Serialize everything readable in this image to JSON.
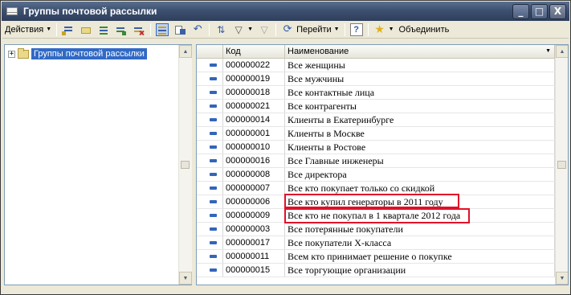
{
  "window": {
    "title": "Группы почтовой рассылки"
  },
  "title_buttons": {
    "minimize": "_",
    "maximize": "□",
    "close": "X"
  },
  "toolbar": {
    "actions_label": "Действия",
    "goto_label": "Перейти",
    "help_label": "?",
    "merge_label": "Объединить"
  },
  "tree": {
    "root_label": "Группы почтовой рассылки",
    "expander": "+"
  },
  "grid": {
    "columns": [
      "Код",
      "Наименование"
    ],
    "rows": [
      {
        "code": "000000022",
        "name": "Все женщины"
      },
      {
        "code": "000000019",
        "name": "Все мужчины"
      },
      {
        "code": "000000018",
        "name": "Все контактные лица"
      },
      {
        "code": "000000021",
        "name": "Все контрагенты"
      },
      {
        "code": "000000014",
        "name": "Клиенты в Екатеринбурге"
      },
      {
        "code": "000000001",
        "name": "Клиенты в Москве"
      },
      {
        "code": "000000010",
        "name": "Клиенты в Ростове"
      },
      {
        "code": "000000016",
        "name": "Все Главные инженеры"
      },
      {
        "code": "000000008",
        "name": "Все директора"
      },
      {
        "code": "000000007",
        "name": "Все кто покупает только со скидкой"
      },
      {
        "code": "000000006",
        "name": "Все кто купил генераторы в 2011 году"
      },
      {
        "code": "000000009",
        "name": "Все кто не покупал в 1 квартале 2012 года"
      },
      {
        "code": "000000003",
        "name": "Все потерянные покупатели"
      },
      {
        "code": "000000017",
        "name": "Все покупатели Х-класса"
      },
      {
        "code": "000000011",
        "name": "Всем кто принимает решение о покупке"
      },
      {
        "code": "000000015",
        "name": "Все торгующие организации"
      }
    ]
  },
  "colors": {
    "highlight_border": "#e0102a",
    "selection": "#316ac5",
    "title_bar": "#3d5070"
  }
}
